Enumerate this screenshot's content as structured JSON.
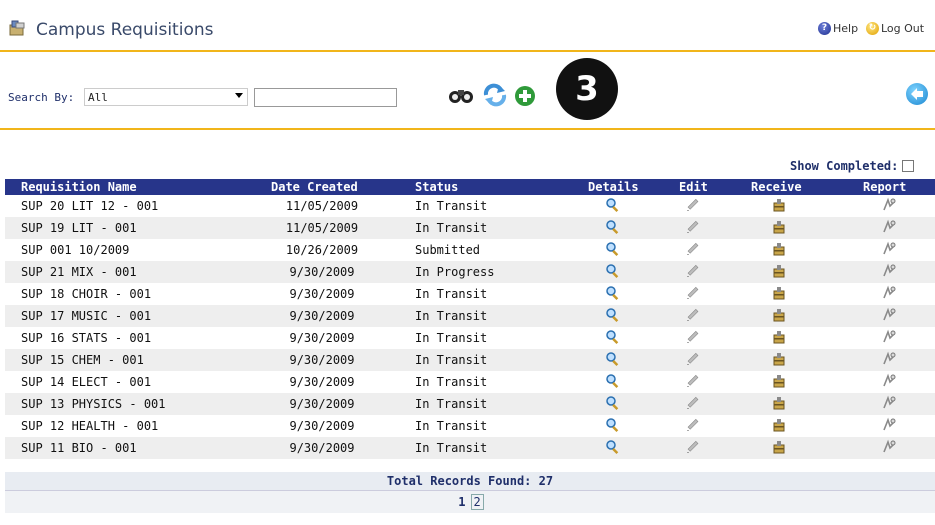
{
  "header": {
    "title": "Campus Requisitions",
    "help_label": "Help",
    "logout_label": "Log Out"
  },
  "search": {
    "label": "Search By:",
    "field_value": "All",
    "query_value": "",
    "step_number": "3"
  },
  "filter": {
    "show_completed_label": "Show Completed:",
    "show_completed_checked": false
  },
  "table": {
    "columns": [
      "Requisition Name",
      "Date Created",
      "Status",
      "Details",
      "Edit",
      "Receive",
      "Report"
    ],
    "rows": [
      {
        "name": "SUP 20 LIT 12 - 001",
        "date": "11/05/2009",
        "status": "In Transit"
      },
      {
        "name": "SUP 19 LIT - 001",
        "date": "11/05/2009",
        "status": "In Transit"
      },
      {
        "name": "SUP 001 10/2009",
        "date": "10/26/2009",
        "status": "Submitted"
      },
      {
        "name": "SUP 21 MIX - 001",
        "date": "9/30/2009",
        "status": "In Progress"
      },
      {
        "name": "SUP 18 CHOIR - 001",
        "date": "9/30/2009",
        "status": "In Transit"
      },
      {
        "name": "SUP 17 MUSIC - 001",
        "date": "9/30/2009",
        "status": "In Transit"
      },
      {
        "name": "SUP 16 STATS - 001",
        "date": "9/30/2009",
        "status": "In Transit"
      },
      {
        "name": "SUP 15 CHEM - 001",
        "date": "9/30/2009",
        "status": "In Transit"
      },
      {
        "name": "SUP 14 ELECT - 001",
        "date": "9/30/2009",
        "status": "In Transit"
      },
      {
        "name": "SUP 13 PHYSICS - 001",
        "date": "9/30/2009",
        "status": "In Transit"
      },
      {
        "name": "SUP 12 HEALTH - 001",
        "date": "9/30/2009",
        "status": "In Transit"
      },
      {
        "name": "SUP 11 BIO - 001",
        "date": "9/30/2009",
        "status": "In Transit"
      }
    ]
  },
  "footer": {
    "total_label": "Total Records Found: 27",
    "pages": [
      "1",
      "2"
    ],
    "current_page": "1"
  },
  "icons": {
    "app": "campus-requisitions-icon",
    "search": "binoculars-icon",
    "refresh": "refresh-icon",
    "add": "add-icon",
    "back": "back-arrow-icon",
    "details": "magnifier-icon",
    "edit": "pencil-icon",
    "receive": "receive-box-icon",
    "report": "report-icon"
  },
  "colors": {
    "accent_rule": "#f1b51a",
    "header_bar": "#27358a",
    "title_text": "#3a4a6a"
  }
}
